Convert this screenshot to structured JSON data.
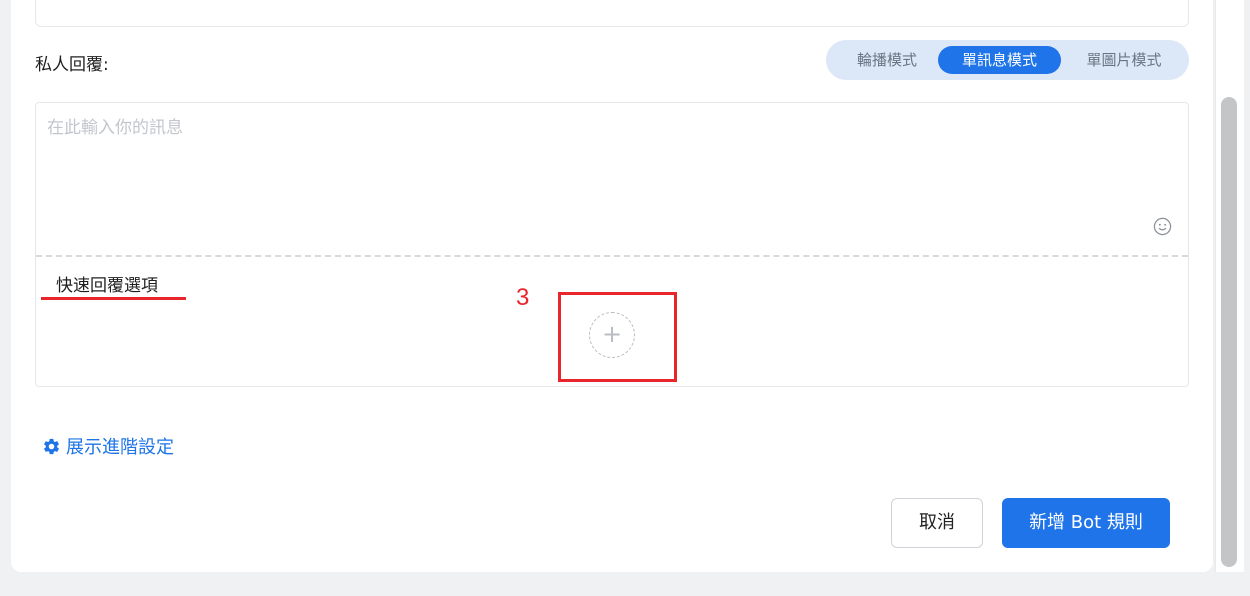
{
  "private_reply": {
    "label": "私人回覆:"
  },
  "mode_switch": {
    "options": [
      "輪播模式",
      "單訊息模式",
      "單圖片模式"
    ],
    "selected": "單訊息模式"
  },
  "message": {
    "placeholder": "在此輸入你的訊息",
    "value": ""
  },
  "quick_reply": {
    "title": "快速回覆選項",
    "add_symbol": "+"
  },
  "annotation": {
    "step_number": "3"
  },
  "advanced": {
    "link_label": "展示進階設定"
  },
  "footer": {
    "cancel_label": "取消",
    "submit_label": "新增 Bot 規則"
  },
  "colors": {
    "accent": "#1e74e8",
    "annotation_red": "#e8262b",
    "switch_bg": "#dce8f7"
  },
  "icons": {
    "emoji": "emoji-icon",
    "settings": "gear-icon",
    "add": "plus-icon"
  }
}
